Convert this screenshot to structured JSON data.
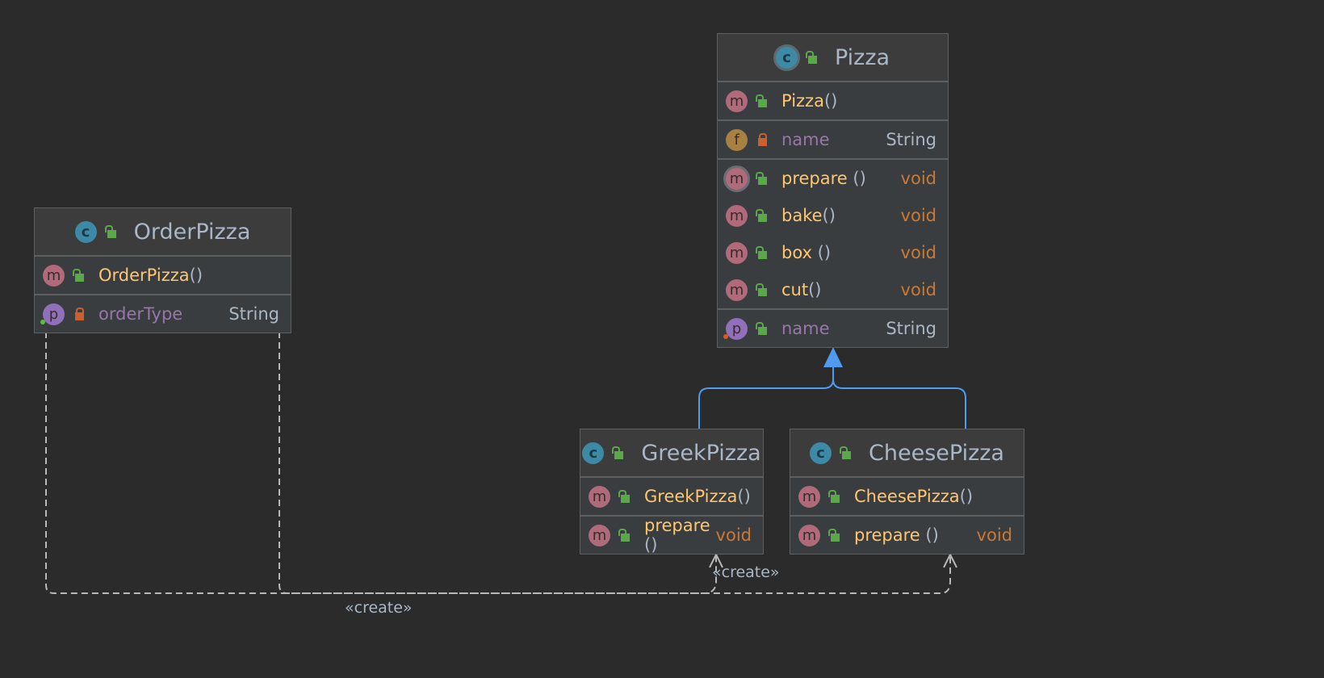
{
  "classes": {
    "pizza": {
      "name": "Pizza",
      "constructor": "Pizza",
      "fields": [
        {
          "name": "name",
          "type": "String"
        }
      ],
      "methods": [
        {
          "name": "prepare",
          "type": "void"
        },
        {
          "name": "bake",
          "type": "void"
        },
        {
          "name": "box",
          "type": "void"
        },
        {
          "name": "cut",
          "type": "void"
        }
      ],
      "property": {
        "name": "name",
        "type": "String"
      }
    },
    "order_pizza": {
      "name": "OrderPizza",
      "constructor": "OrderPizza",
      "property": {
        "name": "orderType",
        "type": "String"
      }
    },
    "greek_pizza": {
      "name": "GreekPizza",
      "constructor": "GreekPizza",
      "methods": [
        {
          "name": "prepare",
          "type": "void"
        }
      ]
    },
    "cheese_pizza": {
      "name": "CheesePizza",
      "constructor": "CheesePizza",
      "methods": [
        {
          "name": "prepare",
          "type": "void"
        }
      ]
    }
  },
  "icons": {
    "class": "c",
    "method": "m",
    "field": "f",
    "property": "p",
    "parens": "()"
  },
  "relations": {
    "create_label_1": "«create»",
    "create_label_2": "«create»"
  },
  "colors": {
    "inherit_line": "#4f9bef",
    "dependency_line": "#b8b8b8"
  }
}
